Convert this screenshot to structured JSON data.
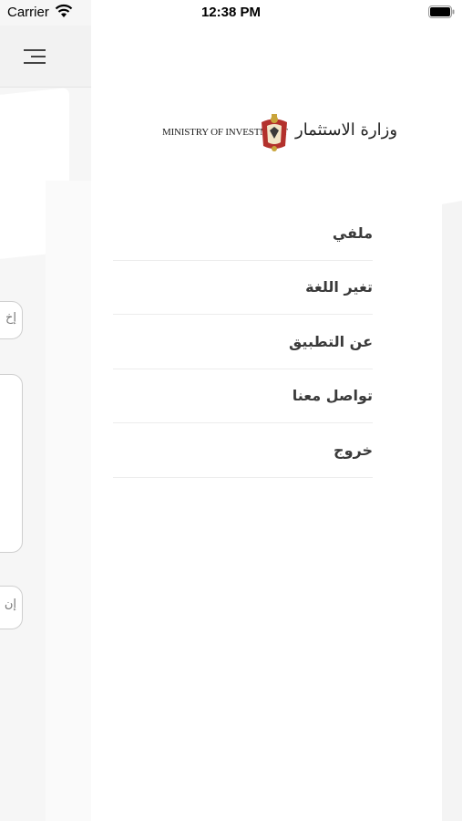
{
  "status_bar": {
    "carrier": "Carrier",
    "time": "12:38 PM"
  },
  "background": {
    "input_1_text": "إخ",
    "input_2_text": "إن"
  },
  "drawer": {
    "logo": {
      "en": "MINISTRY OF INVESTMENT",
      "ar": "وزارة الاستثمار"
    },
    "menu": [
      {
        "label": "ملفي"
      },
      {
        "label": "تغير اللغة"
      },
      {
        "label": "عن التطبيق"
      },
      {
        "label": "تواصل معنا"
      },
      {
        "label": "خروج"
      }
    ]
  }
}
